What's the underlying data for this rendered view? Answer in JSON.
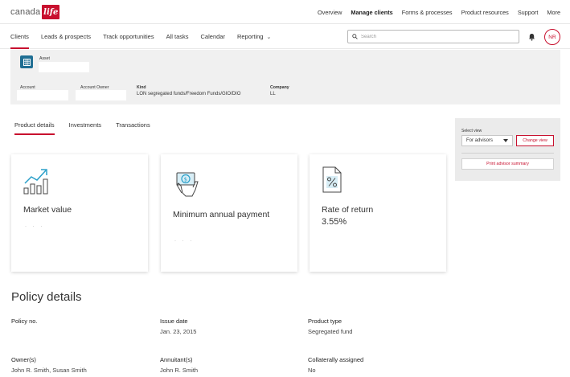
{
  "brand": {
    "name": "canada",
    "logo_text": "life"
  },
  "top_nav": {
    "items": [
      "Overview",
      "Manage clients",
      "Forms & processes",
      "Product resources",
      "Support",
      "More"
    ],
    "active": "Manage clients"
  },
  "sub_nav": {
    "items": [
      "Clients",
      "Leads & prospects",
      "Track opportunities",
      "All tasks",
      "Calendar",
      "Reporting"
    ],
    "active": "Clients"
  },
  "search": {
    "placeholder": "Search"
  },
  "user": {
    "initials": "NR"
  },
  "account_info": {
    "asset_label": "Asset",
    "account_label": "Account",
    "account_owner_label": "Account Owner",
    "kind_label": "Kind",
    "kind_value": "LON segregated funds/Freedom Funds/GIO/DIO",
    "company_label": "Company",
    "company_value": "LL"
  },
  "tabs": {
    "items": [
      "Product details",
      "Investments",
      "Transactions"
    ],
    "active": "Product details"
  },
  "select_view": {
    "label": "Select view",
    "selected": "For advisors",
    "change_button": "Change view",
    "print_button": "Print advisor summary"
  },
  "cards": [
    {
      "icon": "growth-chart-icon",
      "title": "Market value",
      "value": ""
    },
    {
      "icon": "money-hand-icon",
      "title": "Minimum annual payment",
      "value": ""
    },
    {
      "icon": "percent-document-icon",
      "title": "Rate of return",
      "value": "3.55%"
    }
  ],
  "policy_details": {
    "title": "Policy details",
    "fields": [
      {
        "label": "Policy no.",
        "value": ""
      },
      {
        "label": "Issue date",
        "value": "Jan. 23, 2015"
      },
      {
        "label": "Product type",
        "value": "Segregated fund"
      },
      {
        "label": "Owner(s)",
        "value": "John R. Smith, Susan Smith"
      },
      {
        "label": "Annuitant(s)",
        "value": "John R. Smith"
      },
      {
        "label": "Collaterally assigned",
        "value": "No"
      }
    ]
  },
  "colors": {
    "brand_red": "#c8102e",
    "asset_blue": "#1f6e93",
    "panel_gray": "#f0f0f0"
  }
}
